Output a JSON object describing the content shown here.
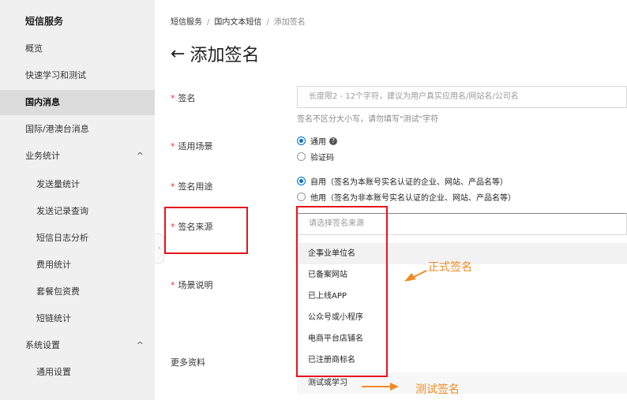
{
  "sidebar": {
    "title": "短信服务",
    "items": [
      {
        "label": "概览"
      },
      {
        "label": "快速学习和测试"
      },
      {
        "label": "国内消息"
      },
      {
        "label": "国际/港澳台消息"
      },
      {
        "label": "业务统计",
        "chevron": "^"
      },
      {
        "label": "发送量统计"
      },
      {
        "label": "发送记录查询"
      },
      {
        "label": "短信日志分析"
      },
      {
        "label": "费用统计"
      },
      {
        "label": "套餐包资费"
      },
      {
        "label": "短链统计"
      },
      {
        "label": "系统设置",
        "chevron": "^"
      },
      {
        "label": "通用设置"
      }
    ],
    "collapse_glyph": "‹"
  },
  "breadcrumb": {
    "items": [
      "短信服务",
      "国内文本短信",
      "添加签名"
    ],
    "sep": "/"
  },
  "page": {
    "back_glyph": "←",
    "title": "添加签名"
  },
  "form": {
    "required_mark": "*",
    "signature": {
      "label": "签名",
      "placeholder": "长度限2 - 12个字符，建议为用户真实应用名/网站名/公司名",
      "hint": "签名不区分大小写，请勿填写\"测试\"字符"
    },
    "scenario": {
      "label": "适用场景",
      "options": [
        "通用",
        "验证码"
      ],
      "help_glyph": "?"
    },
    "usage": {
      "label": "签名用途",
      "options": [
        "自用（签名为本账号实名认证的企业、网站、产品名等）",
        "他用（签名为非本账号实名认证的企业、网站、产品名等）"
      ]
    },
    "source": {
      "label": "签名来源",
      "placeholder": "请选择签名来源",
      "options": [
        "企事业单位名",
        "已备案网站",
        "已上线APP",
        "公众号或小程序",
        "电商平台店铺名",
        "已注册商标名",
        "测试或学习"
      ]
    },
    "scene_desc": {
      "label": "场景说明"
    },
    "more": {
      "label": "更多资料"
    }
  },
  "annotations": {
    "formal": "正式签名",
    "test": "测试签名",
    "color": "#f08a24",
    "box_color": "#e8141b"
  }
}
